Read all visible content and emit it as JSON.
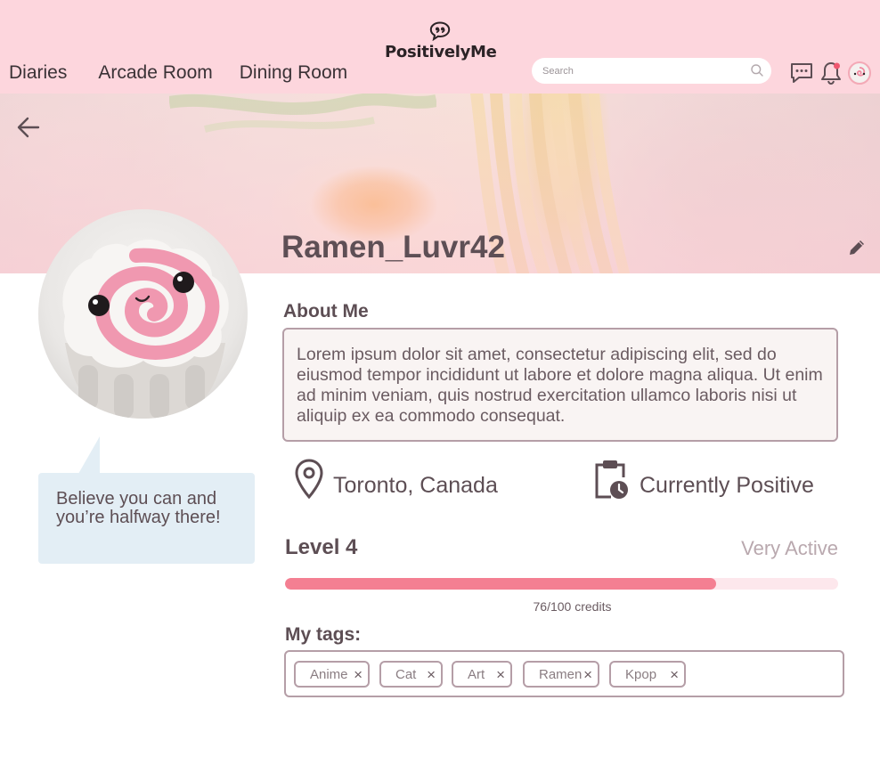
{
  "header": {
    "logo_text": "PositivelyMe",
    "nav": [
      {
        "label": "Diaries"
      },
      {
        "label": "Arcade Room"
      },
      {
        "label": "Dining Room"
      }
    ],
    "search": {
      "placeholder": "Search",
      "value": ""
    },
    "icons": [
      "chat-bubble-icon",
      "bell-icon",
      "avatar"
    ],
    "notification_dot": true
  },
  "profile": {
    "username": "Ramen_Luvr42",
    "quote": "Believe you can and you’re halfway there!",
    "about_label": "About Me",
    "about_text": "Lorem ipsum dolor sit amet, consectetur adipiscing elit, sed do eiusmod tempor incididunt ut labore et dolore magna aliqua. Ut enim ad minim veniam, quis nostrud exercitation ullamco laboris nisi ut aliquip ex ea commodo consequat.",
    "location": "Toronto, Canada",
    "status": "Currently Positive",
    "level": "Level 4",
    "activity": "Very Active",
    "credits_text": "76/100 credits",
    "progress": 0.78,
    "tags_label": "My tags:",
    "tags": [
      "Anime",
      "Cat",
      "Art",
      "Ramen",
      "Kpop"
    ]
  },
  "colors": {
    "header_bg": "#fdd6dd",
    "accent": "#f47f92",
    "quote_bg": "#e3eef5",
    "text": "#5d4e54",
    "muted": "#b9a8ae"
  }
}
